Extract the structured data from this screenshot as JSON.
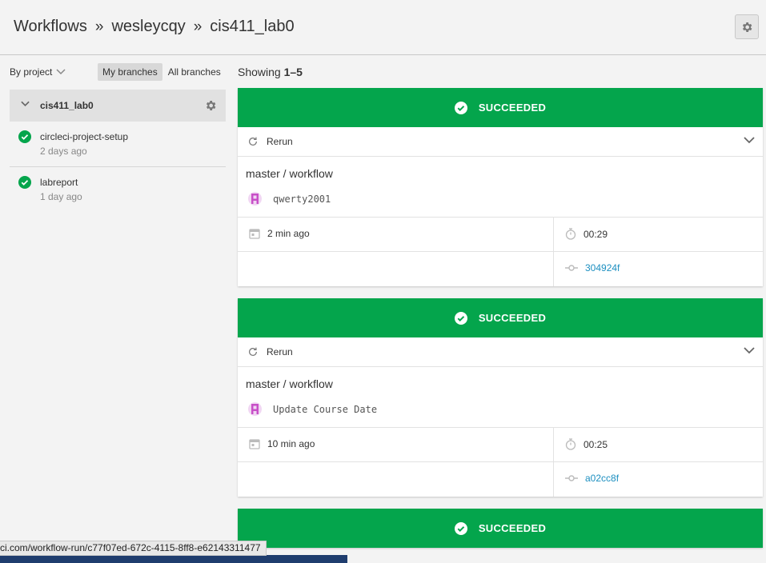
{
  "header": {
    "crumbs": [
      "Workflows",
      "wesleycqy",
      "cis411_lab0"
    ],
    "separator": "»",
    "settings_icon": "gear-icon"
  },
  "sidebar": {
    "group_by_label": "By project",
    "branch_filters": [
      "My branches",
      "All branches"
    ],
    "active_filter": "My branches",
    "project": {
      "name": "cis411_lab0"
    },
    "branches": [
      {
        "name": "circleci-project-setup",
        "time": "2 days ago",
        "status": "success"
      },
      {
        "name": "labreport",
        "time": "1 day ago",
        "status": "success"
      }
    ]
  },
  "main": {
    "showing_prefix": "Showing",
    "showing_range": "1–5",
    "cards": [
      {
        "status": "SUCCEEDED",
        "rerun_label": "Rerun",
        "workflow": "master / workflow",
        "commit_message": "qwerty2001",
        "time_ago": "2 min ago",
        "duration": "00:29",
        "sha": "304924f"
      },
      {
        "status": "SUCCEEDED",
        "rerun_label": "Rerun",
        "workflow": "master / workflow",
        "commit_message": "Update Course Date",
        "time_ago": "10 min ago",
        "duration": "00:25",
        "sha": "a02cc8f"
      },
      {
        "status": "SUCCEEDED"
      }
    ]
  },
  "status_bar": {
    "url": "ci.com/workflow-run/c77f07ed-672c-4115-8ff8-e62143311477"
  },
  "colors": {
    "success": "#04a54c",
    "link": "#1c8fc0",
    "avatar": "#c850c8"
  }
}
